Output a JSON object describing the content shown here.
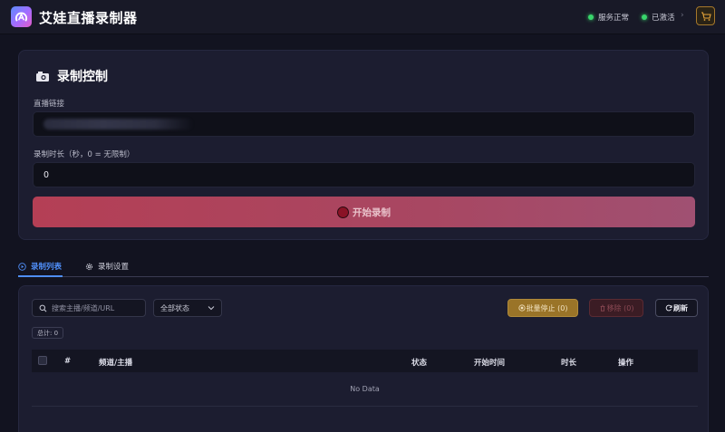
{
  "app": {
    "title": "艾娃直播录制器"
  },
  "header": {
    "service_status": "服务正常",
    "license_status": "已激活",
    "chevron": "›"
  },
  "control": {
    "title": "录制控制",
    "url_label": "直播链接",
    "url_value": "",
    "duration_label": "录制时长（秒，0 = 无限制）",
    "duration_value": "0",
    "start_label": "开始录制"
  },
  "tabs": [
    {
      "label": "录制列表",
      "active": true
    },
    {
      "label": "录制设置",
      "active": false
    }
  ],
  "list": {
    "search_placeholder": "搜索主播/频道/URL",
    "status_filter": "全部状态",
    "batch_stop": "批量停止 (0)",
    "remove": "移除 (0)",
    "refresh": "刷新",
    "total": "总计: 0",
    "columns": [
      "#",
      "频道/主播",
      "状态",
      "开始时间",
      "时长",
      "操作"
    ],
    "rows": [],
    "empty_text": "No Data"
  },
  "colors": {
    "accent": "#4f8ef7",
    "record": "#b43f55",
    "warning": "#9a7428",
    "online": "#38d66b"
  }
}
